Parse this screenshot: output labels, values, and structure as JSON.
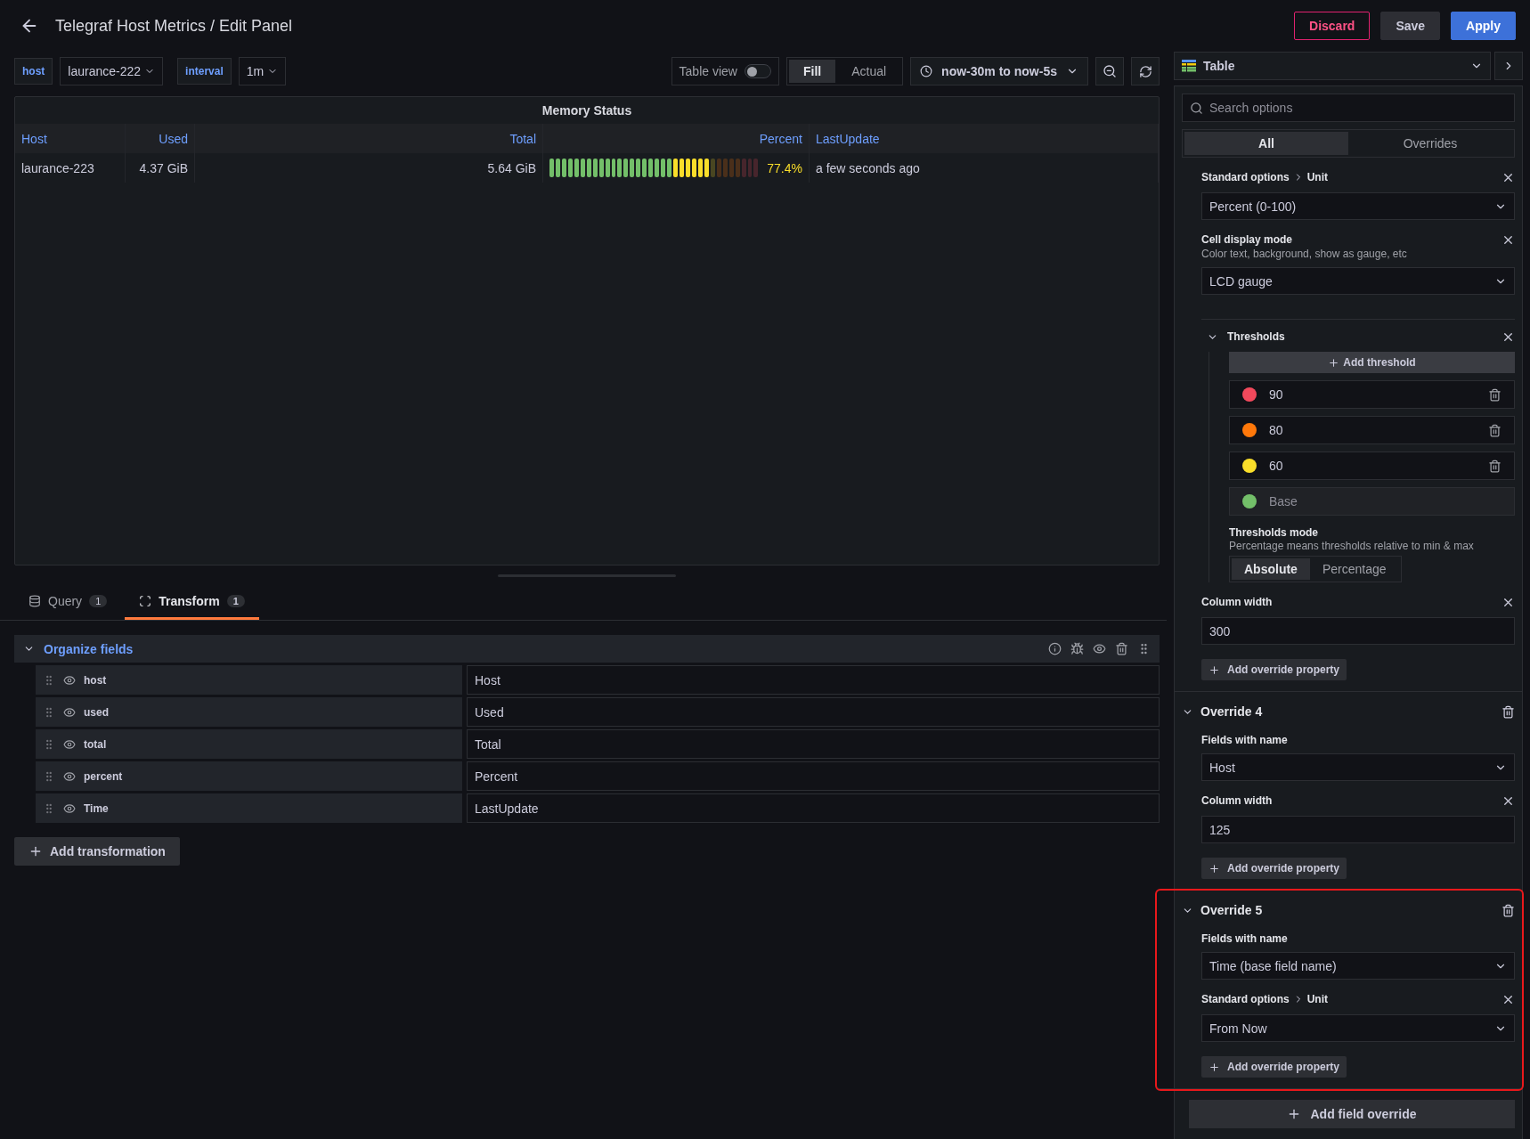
{
  "header": {
    "title": "Telegraf Host Metrics / Edit Panel",
    "buttons": [
      {
        "label": "Discard",
        "kind": "danger"
      },
      {
        "label": "Save",
        "kind": "secondary"
      },
      {
        "label": "Apply",
        "kind": "primary"
      }
    ]
  },
  "variables": [
    {
      "label": "host",
      "value": "laurance-222"
    },
    {
      "label": "interval",
      "value": "1m"
    }
  ],
  "toolbar": {
    "table_view": {
      "label": "Table view",
      "on": false
    },
    "size_modes": [
      {
        "label": "Fill",
        "selected": true
      },
      {
        "label": "Actual",
        "selected": false
      }
    ],
    "time_range": "now-30m to now-5s",
    "visualization": "Table"
  },
  "panel": {
    "title": "Memory Status",
    "columns": [
      {
        "label": "Host"
      },
      {
        "label": "Used"
      },
      {
        "label": "Total"
      },
      {
        "label": "Percent"
      },
      {
        "label": "LastUpdate"
      }
    ],
    "rows": [
      {
        "cells": [
          {
            "kind": "text",
            "text": "laurance-223"
          },
          {
            "kind": "text",
            "text": "4.37 GiB"
          },
          {
            "kind": "text",
            "text": "5.64 GiB"
          },
          {
            "kind": "gauge",
            "text": "77.4%",
            "level": 0.774
          },
          {
            "kind": "text",
            "text": "a few seconds ago"
          }
        ]
      }
    ]
  },
  "editor_tabs": [
    {
      "kind": "query",
      "label": "Query",
      "count": "1",
      "selected": false
    },
    {
      "kind": "transform",
      "label": "Transform",
      "count": "1",
      "selected": true
    }
  ],
  "transformation": {
    "title": "Organize fields",
    "expanded": true,
    "fields": [
      {
        "name": "host",
        "rename": "Host"
      },
      {
        "name": "used",
        "rename": "Used"
      },
      {
        "name": "total",
        "rename": "Total"
      },
      {
        "name": "percent",
        "rename": "Percent"
      },
      {
        "name": "Time",
        "rename": "LastUpdate"
      }
    ],
    "add_button": "Add transformation"
  },
  "options": {
    "search_placeholder": "Search options",
    "tabs": [
      {
        "label": "All",
        "selected": true
      },
      {
        "label": "Overrides",
        "selected": false
      }
    ],
    "overrides": [
      {
        "highlighted": false,
        "properties": [
          {
            "kind": "select",
            "label": "Standard options",
            "sublabel": "Unit",
            "value": "Percent (0-100)"
          },
          {
            "kind": "select",
            "label": "Cell display mode",
            "description": "Color text, background, show as gauge, etc",
            "value": "LCD gauge"
          },
          {
            "kind": "thresholds",
            "label": "Thresholds",
            "expanded": true,
            "add_label": "Add threshold",
            "steps": [
              {
                "value": "90",
                "color": "#f2495c"
              },
              {
                "value": "80",
                "color": "#ff780a"
              },
              {
                "value": "60",
                "color": "#fade2a"
              },
              {
                "value": "Base",
                "color": "#73bf69"
              }
            ],
            "mode_label": "Thresholds mode",
            "mode_description": "Percentage means thresholds relative to min & max",
            "modes": [
              {
                "label": "Absolute",
                "selected": true
              },
              {
                "label": "Percentage",
                "selected": false
              }
            ]
          },
          {
            "kind": "input",
            "label": "Column width",
            "value": "300"
          }
        ],
        "add_property": "Add override property"
      },
      {
        "title": "Override 4",
        "expanded": true,
        "highlighted": false,
        "matcher_label": "Fields with name",
        "matcher_value": "Host",
        "properties": [
          {
            "kind": "input",
            "label": "Column width",
            "value": "125"
          }
        ],
        "add_property": "Add override property"
      },
      {
        "title": "Override 5",
        "expanded": true,
        "highlighted": true,
        "matcher_label": "Fields with name",
        "matcher_value": "Time (base field name)",
        "properties": [
          {
            "kind": "select",
            "label": "Standard options",
            "sublabel": "Unit",
            "value": "From Now"
          }
        ],
        "add_property": "Add override property"
      }
    ],
    "add_field_override": "Add field override"
  }
}
